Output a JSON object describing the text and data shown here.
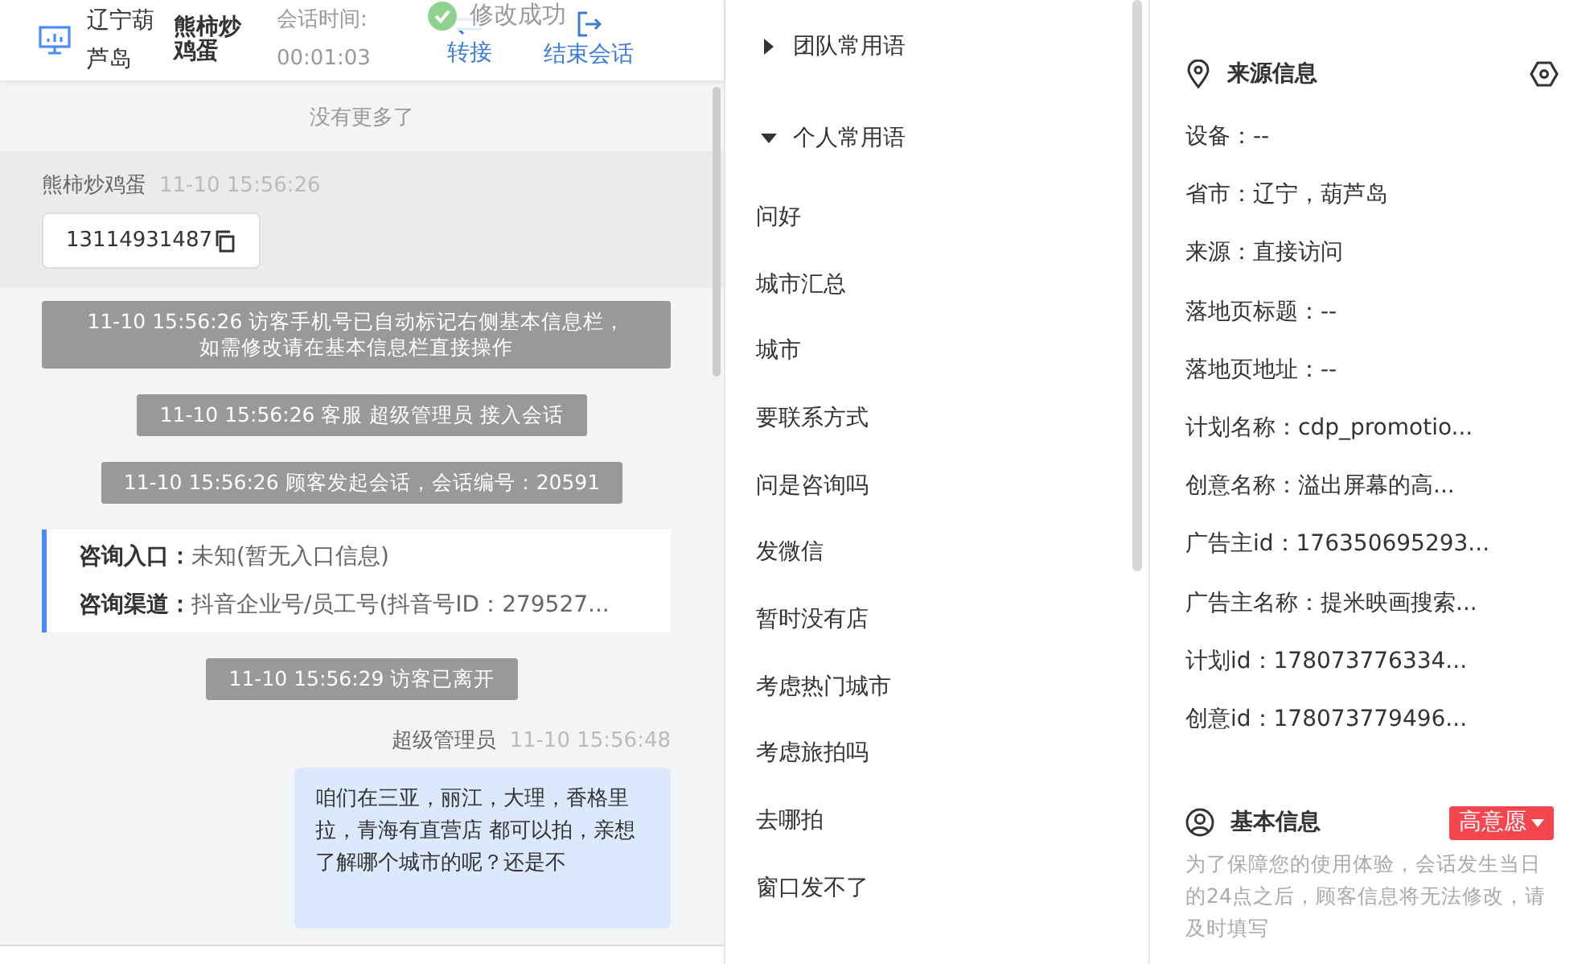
{
  "header": {
    "location": "辽宁葫芦岛",
    "visitor": "熊柿炒鸡蛋",
    "session_label": "会话时间:",
    "session_time": "00:01:03",
    "actions": [
      {
        "kind": "transfer",
        "label": "转接"
      },
      {
        "kind": "end",
        "label": "结束会话"
      }
    ]
  },
  "toast": {
    "text": "修改成功"
  },
  "chat": [
    {
      "kind": "notice",
      "text": "没有更多了"
    },
    {
      "kind": "visitor",
      "name": "熊柿炒鸡蛋",
      "time": "11-10 15:56:26",
      "text": "13114931487"
    },
    {
      "kind": "system",
      "text": "11-10 15:56:26 访客手机号已自动标记右侧基本信息栏，如需修改请在基本信息栏直接操作"
    },
    {
      "kind": "system",
      "text": "11-10 15:56:26 客服 超级管理员 接入会话"
    },
    {
      "kind": "system",
      "text": "11-10 15:56:26 顾客发起会话，会话编号：20591"
    },
    {
      "kind": "entry",
      "rows": [
        {
          "label": "咨询入口：",
          "value": "未知(暂无入口信息)"
        },
        {
          "label": "咨询渠道：",
          "value": "抖音企业号/员工号(抖音号ID：279527..."
        }
      ]
    },
    {
      "kind": "system",
      "text": "11-10 15:56:29 访客已离开"
    },
    {
      "kind": "agent",
      "name": "超级管理员",
      "time": "11-10 15:56:48",
      "text": "咱们在三亚，丽江，大理，香格里拉，青海有直营店 都可以拍，亲想了解哪个城市的呢？还是不"
    }
  ],
  "phrases": [
    {
      "title": "团队常用语",
      "expanded": false
    },
    {
      "title": "个人常用语",
      "expanded": true,
      "items": [
        "问好",
        "城市汇总",
        "城市",
        "要联系方式",
        "问是咨询吗",
        "发微信",
        "暂时没有店",
        "考虑热门城市",
        "考虑旅拍吗",
        "去哪拍",
        "窗口发不了"
      ]
    }
  ],
  "source": {
    "title": "来源信息",
    "rows": [
      "设备：--",
      "省市：辽宁，葫芦岛",
      "来源：直接访问",
      "落地页标题：--",
      "落地页地址：--",
      "计划名称：cdp_promotio...",
      "创意名称：溢出屏幕的高...",
      "广告主id：176350695293...",
      "广告主名称：提米映画搜索...",
      "计划id：178073776334...",
      "创意id：178073779496..."
    ]
  },
  "basic": {
    "title": "基本信息",
    "tag": "高意愿",
    "note": "为了保障您的使用体验，会话发生当日的24点之后，顾客信息将无法修改，请及时填写"
  }
}
